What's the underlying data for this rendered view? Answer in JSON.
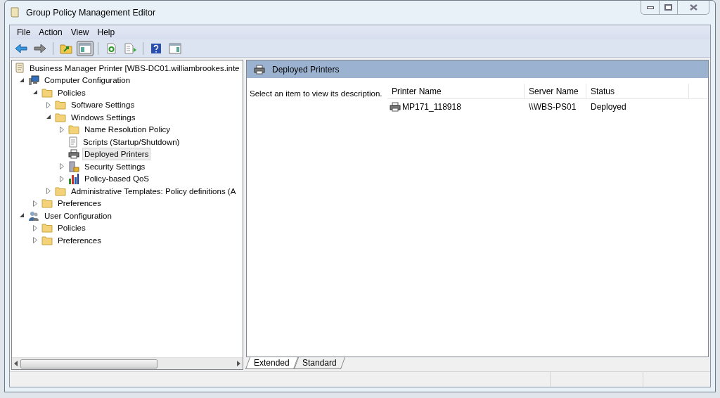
{
  "window": {
    "title": "Group Policy Management Editor"
  },
  "menu": [
    "File",
    "Action",
    "View",
    "Help"
  ],
  "toolbar": [
    [
      {
        "kind": "back",
        "pressed": false
      },
      {
        "kind": "forward",
        "pressed": false
      }
    ],
    [
      {
        "kind": "up",
        "pressed": false
      },
      {
        "kind": "tree",
        "pressed": true
      }
    ],
    [
      {
        "kind": "refresh",
        "pressed": false
      },
      {
        "kind": "export",
        "pressed": false
      }
    ],
    [
      {
        "kind": "help",
        "pressed": false
      },
      {
        "kind": "actions",
        "pressed": false
      }
    ]
  ],
  "tree": [
    {
      "label": "Business Manager Printer [WBS-DC01.williambrookes.inte",
      "kind": "scroll",
      "selected": false,
      "children": [
        {
          "label": "Computer Configuration",
          "kind": "computer",
          "expanded": true,
          "selected": false,
          "children": [
            {
              "label": "Policies",
              "kind": "folder",
              "expanded": true,
              "selected": false,
              "children": [
                {
                  "label": "Software Settings",
                  "kind": "folder",
                  "expanded": false,
                  "selected": false
                },
                {
                  "label": "Windows Settings",
                  "kind": "folder",
                  "expanded": true,
                  "selected": false,
                  "children": [
                    {
                      "label": "Name Resolution Policy",
                      "kind": "folder",
                      "expanded": false,
                      "selected": false
                    },
                    {
                      "label": "Scripts (Startup/Shutdown)",
                      "kind": "script",
                      "selected": false
                    },
                    {
                      "label": "Deployed Printers",
                      "kind": "printer",
                      "selected": true
                    },
                    {
                      "label": "Security Settings",
                      "kind": "security",
                      "expanded": false,
                      "selected": false
                    },
                    {
                      "label": "Policy-based QoS",
                      "kind": "chart",
                      "expanded": false,
                      "selected": false
                    }
                  ]
                },
                {
                  "label": "Administrative Templates: Policy definitions (A",
                  "kind": "folder",
                  "expanded": false,
                  "selected": false
                }
              ]
            },
            {
              "label": "Preferences",
              "kind": "folder",
              "expanded": false,
              "selected": false
            }
          ]
        },
        {
          "label": "User Configuration",
          "kind": "user",
          "expanded": true,
          "selected": false,
          "children": [
            {
              "label": "Policies",
              "kind": "folder",
              "expanded": false,
              "selected": false
            },
            {
              "label": "Preferences",
              "kind": "folder",
              "expanded": false,
              "selected": false
            }
          ]
        }
      ]
    }
  ],
  "details": {
    "title": "Deployed Printers",
    "description": "Select an item to view its description.",
    "columns": [
      "Printer Name",
      "Server Name",
      "Status"
    ],
    "rows": [
      {
        "cells": [
          "MP171_118918",
          "\\\\WBS-PS01",
          "Deployed"
        ],
        "selected": false
      }
    ]
  },
  "view_tabs": [
    {
      "label": "Extended",
      "selected": true
    },
    {
      "label": "Standard",
      "selected": false
    }
  ]
}
